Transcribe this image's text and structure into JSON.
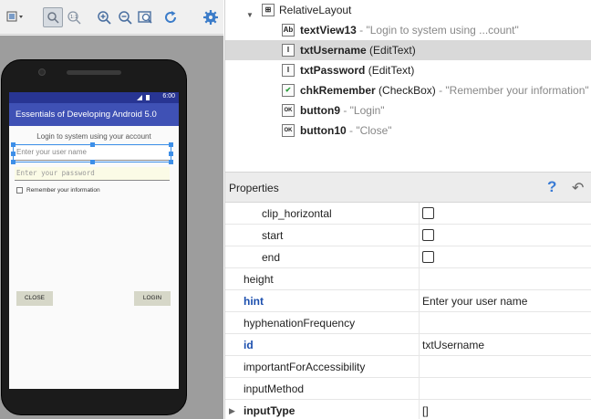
{
  "preview": {
    "toolbar": {
      "icons": [
        "dropdown-icon",
        "select-icon",
        "actual-size-icon",
        "zoom-in-icon",
        "zoom-out-icon",
        "zoom-fit-icon",
        "refresh-icon",
        "settings-icon"
      ]
    },
    "device": {
      "status_time": "6:00",
      "app_title": "Essentials of Developing Android 5.0",
      "login_label": "Login to system using your account",
      "username_hint": "Enter your user name",
      "password_hint": "Enter your password",
      "remember_label": "Remember your information",
      "close_button": "CLOSE",
      "login_button": "LOGIN"
    }
  },
  "tree": {
    "root": {
      "name": "RelativeLayout"
    },
    "items": [
      {
        "icon": "Ab",
        "name": "textView13",
        "type": "",
        "desc": " - \"Login to system using ...count\""
      },
      {
        "icon": "I",
        "name": "txtUsername",
        "type": " (EditText)",
        "desc": ""
      },
      {
        "icon": "I",
        "name": "txtPassword",
        "type": " (EditText)",
        "desc": ""
      },
      {
        "icon": "✔",
        "name": "chkRemember",
        "type": " (CheckBox)",
        "desc": " - \"Remember your information\""
      },
      {
        "icon": "OK",
        "name": "button9",
        "type": "",
        "desc": " - \"Login\""
      },
      {
        "icon": "OK",
        "name": "button10",
        "type": "",
        "desc": " - \"Close\""
      }
    ]
  },
  "properties": {
    "title": "Properties",
    "help_label": "?",
    "rows": [
      {
        "name": "clip_horizontal",
        "value": "",
        "checkbox": true
      },
      {
        "name": "start",
        "value": "",
        "checkbox": true
      },
      {
        "name": "end",
        "value": "",
        "checkbox": true
      },
      {
        "name": "height",
        "value": ""
      },
      {
        "name": "hint",
        "value": "Enter your user name"
      },
      {
        "name": "hyphenationFrequency",
        "value": ""
      },
      {
        "name": "id",
        "value": "txtUsername"
      },
      {
        "name": "importantForAccessibility",
        "value": ""
      },
      {
        "name": "inputMethod",
        "value": ""
      },
      {
        "name": "inputType",
        "value": "[]"
      }
    ]
  },
  "colors": {
    "app_bar": "#3f51b5",
    "status_bar": "#283593",
    "selection": "#3d8fe8",
    "highlight_prop": "#1c4fae"
  }
}
